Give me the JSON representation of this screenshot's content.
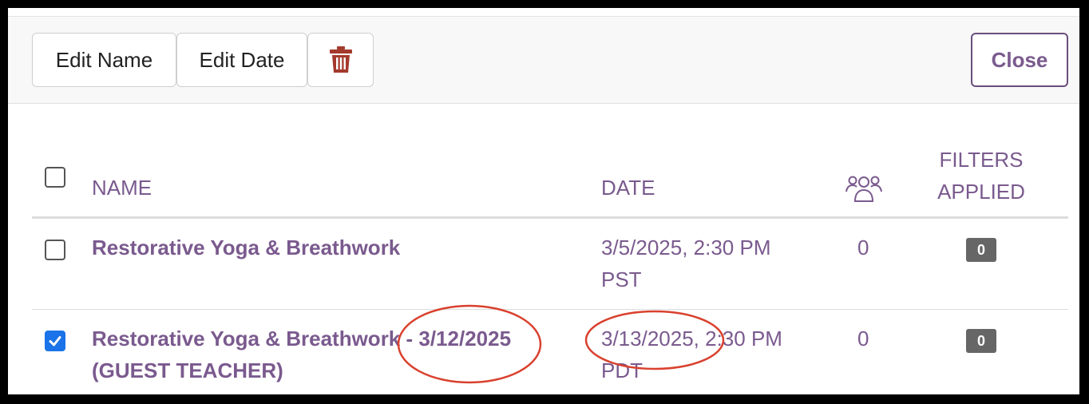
{
  "toolbar": {
    "edit_name_label": "Edit Name",
    "edit_date_label": "Edit Date",
    "delete_icon": "trash-icon",
    "close_label": "Close"
  },
  "table": {
    "columns": {
      "name": "NAME",
      "date": "DATE",
      "attendees_icon": "people-icon",
      "filters_line1": "FILTERS",
      "filters_line2": "APPLIED"
    },
    "rows": [
      {
        "checked": false,
        "name": "Restorative Yoga & Breathwork",
        "date_line1": "3/5/2025, 2:30 PM",
        "date_line2": "PST",
        "count": "0",
        "filters": "0"
      },
      {
        "checked": true,
        "name_line1": "Restorative Yoga & Breathwork - 3/12/2025",
        "name_line2": "(GUEST TEACHER)",
        "date_line1": "3/13/2025, 2:30 PM",
        "date_line2": "PDT",
        "count": "0",
        "filters": "0"
      }
    ]
  },
  "colors": {
    "accent": "#7a5a8e",
    "delete_icon": "#a33a2c",
    "checkbox_checked": "#1a73e8",
    "badge": "#666666",
    "annotation": "#d9412e"
  }
}
